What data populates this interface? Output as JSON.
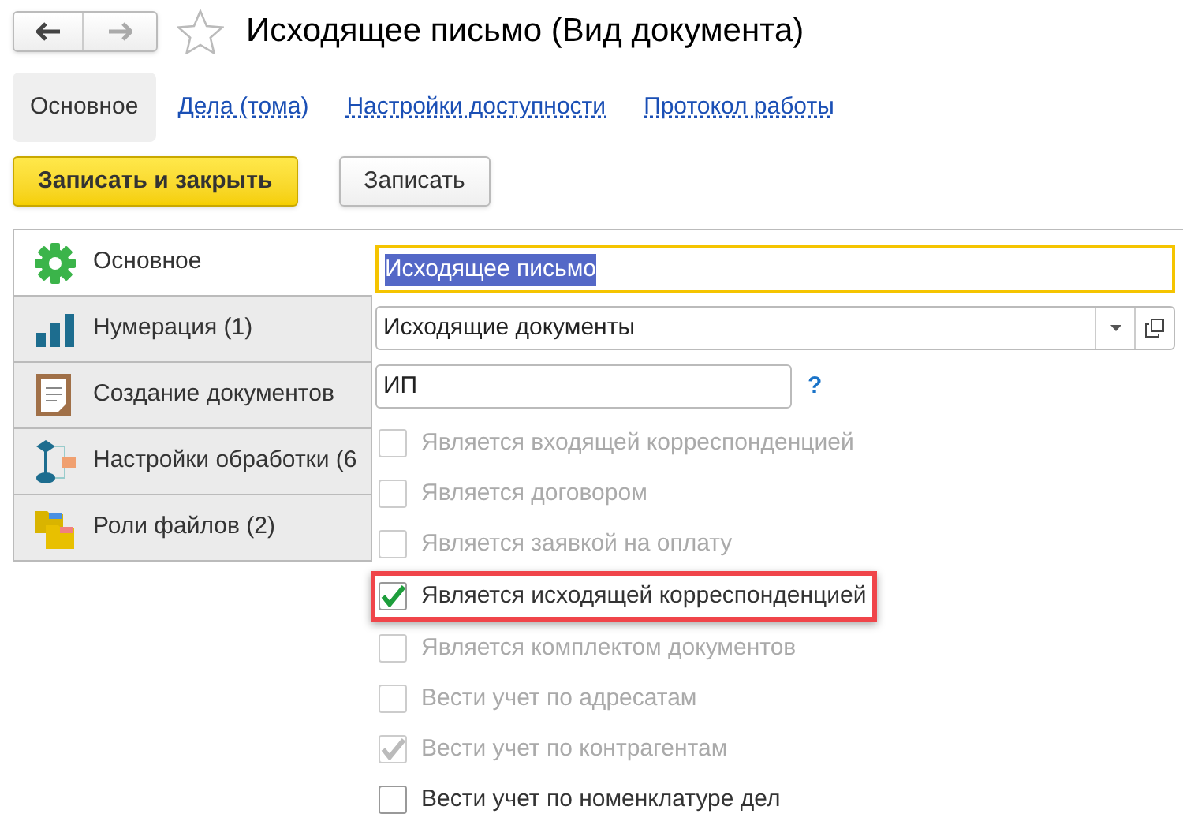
{
  "window": {
    "title": "Исходящее письмо (Вид документа)",
    "favorite": false
  },
  "top_tabs": [
    {
      "label": "Основное",
      "selected": true
    },
    {
      "label": "Дела (тома)",
      "selected": false
    },
    {
      "label": "Настройки доступности",
      "selected": false
    },
    {
      "label": "Протокол работы",
      "selected": false
    }
  ],
  "buttons": [
    {
      "label": "Записать и закрыть",
      "kind": "primary"
    },
    {
      "label": "Записать",
      "kind": "default"
    }
  ],
  "side_tabs": [
    {
      "label": "Основное",
      "kind": "gear",
      "selected": true
    },
    {
      "label": "Нумерация (1)",
      "kind": "numbers",
      "selected": false
    },
    {
      "label": "Создание документов",
      "kind": "document",
      "selected": false
    },
    {
      "label": "Настройки обработки (6",
      "kind": "flow",
      "selected": false
    },
    {
      "label": "Роли файлов (2)",
      "kind": "folders",
      "selected": false
    }
  ],
  "name_field": {
    "value": "Исходящее письмо",
    "focused": true
  },
  "group_field": {
    "value": "Исходящие документы"
  },
  "prefix_field": {
    "value": "ИП",
    "help": "?"
  },
  "checkboxes": [
    {
      "label": "Является входящей корреспонденцией",
      "checked": false,
      "disabled": true,
      "highlighted": false
    },
    {
      "label": "Является договором",
      "checked": false,
      "disabled": true,
      "highlighted": false
    },
    {
      "label": "Является заявкой на оплату",
      "checked": false,
      "disabled": true,
      "highlighted": false
    },
    {
      "label": "Является исходящей корреспонденцией",
      "checked": true,
      "disabled": false,
      "highlighted": true
    },
    {
      "label": "Является комплектом документов",
      "checked": false,
      "disabled": true,
      "highlighted": false
    },
    {
      "label": "Вести учет по адресатам",
      "checked": false,
      "disabled": true,
      "highlighted": false
    },
    {
      "label": "Вести учет по контрагентам",
      "checked": true,
      "disabled": true,
      "highlighted": false
    },
    {
      "label": "Вести учет по номенклатуре дел",
      "checked": false,
      "disabled": false,
      "highlighted": false
    }
  ]
}
